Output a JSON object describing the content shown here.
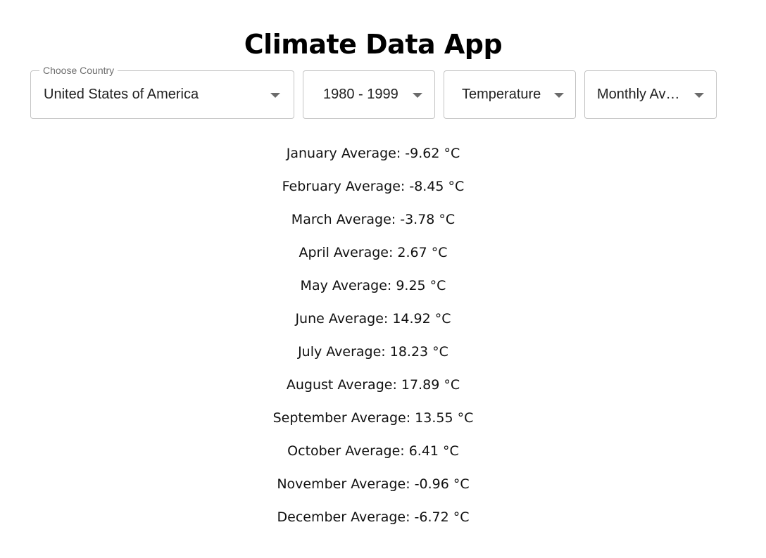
{
  "app": {
    "title": "Climate Data App"
  },
  "filters": {
    "country": {
      "label": "Choose Country",
      "value": "United States of America"
    },
    "period": {
      "value": "1980 - 1999"
    },
    "variable": {
      "value": "Temperature"
    },
    "statistic": {
      "value": "Monthly Av…"
    }
  },
  "results": [
    "January Average: -9.62 °C",
    "February Average: -8.45 °C",
    "March Average: -3.78 °C",
    "April Average: 2.67 °C",
    "May Average: 9.25 °C",
    "June Average: 14.92 °C",
    "July Average: 18.23 °C",
    "August Average: 17.89 °C",
    "September Average: 13.55 °C",
    "October Average: 6.41 °C",
    "November Average: -0.96 °C",
    "December Average: -6.72 °C"
  ],
  "icons": {
    "dropdown": "chevron-down-icon"
  },
  "colors": {
    "border": "#c4c4c4",
    "legend": "#6e6e6e",
    "arrow": "#6b6b6b"
  }
}
